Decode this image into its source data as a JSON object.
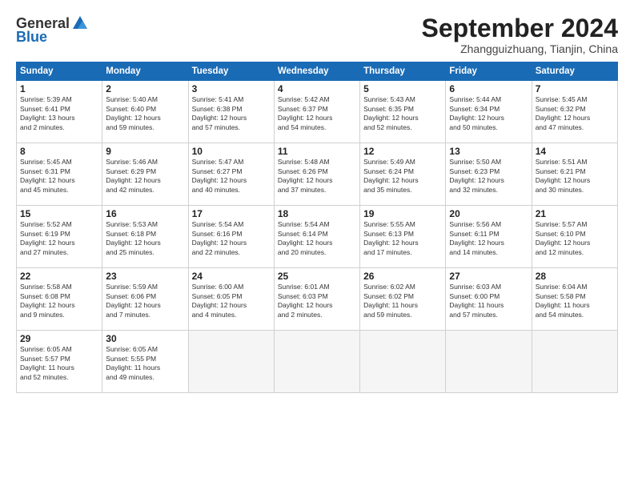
{
  "logo": {
    "general": "General",
    "blue": "Blue"
  },
  "title": "September 2024",
  "subtitle": "Zhangguizhuang, Tianjin, China",
  "days_of_week": [
    "Sunday",
    "Monday",
    "Tuesday",
    "Wednesday",
    "Thursday",
    "Friday",
    "Saturday"
  ],
  "weeks": [
    [
      {
        "day": "1",
        "info": "Sunrise: 5:39 AM\nSunset: 6:41 PM\nDaylight: 13 hours\nand 2 minutes."
      },
      {
        "day": "2",
        "info": "Sunrise: 5:40 AM\nSunset: 6:40 PM\nDaylight: 12 hours\nand 59 minutes."
      },
      {
        "day": "3",
        "info": "Sunrise: 5:41 AM\nSunset: 6:38 PM\nDaylight: 12 hours\nand 57 minutes."
      },
      {
        "day": "4",
        "info": "Sunrise: 5:42 AM\nSunset: 6:37 PM\nDaylight: 12 hours\nand 54 minutes."
      },
      {
        "day": "5",
        "info": "Sunrise: 5:43 AM\nSunset: 6:35 PM\nDaylight: 12 hours\nand 52 minutes."
      },
      {
        "day": "6",
        "info": "Sunrise: 5:44 AM\nSunset: 6:34 PM\nDaylight: 12 hours\nand 50 minutes."
      },
      {
        "day": "7",
        "info": "Sunrise: 5:45 AM\nSunset: 6:32 PM\nDaylight: 12 hours\nand 47 minutes."
      }
    ],
    [
      {
        "day": "8",
        "info": "Sunrise: 5:45 AM\nSunset: 6:31 PM\nDaylight: 12 hours\nand 45 minutes."
      },
      {
        "day": "9",
        "info": "Sunrise: 5:46 AM\nSunset: 6:29 PM\nDaylight: 12 hours\nand 42 minutes."
      },
      {
        "day": "10",
        "info": "Sunrise: 5:47 AM\nSunset: 6:27 PM\nDaylight: 12 hours\nand 40 minutes."
      },
      {
        "day": "11",
        "info": "Sunrise: 5:48 AM\nSunset: 6:26 PM\nDaylight: 12 hours\nand 37 minutes."
      },
      {
        "day": "12",
        "info": "Sunrise: 5:49 AM\nSunset: 6:24 PM\nDaylight: 12 hours\nand 35 minutes."
      },
      {
        "day": "13",
        "info": "Sunrise: 5:50 AM\nSunset: 6:23 PM\nDaylight: 12 hours\nand 32 minutes."
      },
      {
        "day": "14",
        "info": "Sunrise: 5:51 AM\nSunset: 6:21 PM\nDaylight: 12 hours\nand 30 minutes."
      }
    ],
    [
      {
        "day": "15",
        "info": "Sunrise: 5:52 AM\nSunset: 6:19 PM\nDaylight: 12 hours\nand 27 minutes."
      },
      {
        "day": "16",
        "info": "Sunrise: 5:53 AM\nSunset: 6:18 PM\nDaylight: 12 hours\nand 25 minutes."
      },
      {
        "day": "17",
        "info": "Sunrise: 5:54 AM\nSunset: 6:16 PM\nDaylight: 12 hours\nand 22 minutes."
      },
      {
        "day": "18",
        "info": "Sunrise: 5:54 AM\nSunset: 6:14 PM\nDaylight: 12 hours\nand 20 minutes."
      },
      {
        "day": "19",
        "info": "Sunrise: 5:55 AM\nSunset: 6:13 PM\nDaylight: 12 hours\nand 17 minutes."
      },
      {
        "day": "20",
        "info": "Sunrise: 5:56 AM\nSunset: 6:11 PM\nDaylight: 12 hours\nand 14 minutes."
      },
      {
        "day": "21",
        "info": "Sunrise: 5:57 AM\nSunset: 6:10 PM\nDaylight: 12 hours\nand 12 minutes."
      }
    ],
    [
      {
        "day": "22",
        "info": "Sunrise: 5:58 AM\nSunset: 6:08 PM\nDaylight: 12 hours\nand 9 minutes."
      },
      {
        "day": "23",
        "info": "Sunrise: 5:59 AM\nSunset: 6:06 PM\nDaylight: 12 hours\nand 7 minutes."
      },
      {
        "day": "24",
        "info": "Sunrise: 6:00 AM\nSunset: 6:05 PM\nDaylight: 12 hours\nand 4 minutes."
      },
      {
        "day": "25",
        "info": "Sunrise: 6:01 AM\nSunset: 6:03 PM\nDaylight: 12 hours\nand 2 minutes."
      },
      {
        "day": "26",
        "info": "Sunrise: 6:02 AM\nSunset: 6:02 PM\nDaylight: 11 hours\nand 59 minutes."
      },
      {
        "day": "27",
        "info": "Sunrise: 6:03 AM\nSunset: 6:00 PM\nDaylight: 11 hours\nand 57 minutes."
      },
      {
        "day": "28",
        "info": "Sunrise: 6:04 AM\nSunset: 5:58 PM\nDaylight: 11 hours\nand 54 minutes."
      }
    ],
    [
      {
        "day": "29",
        "info": "Sunrise: 6:05 AM\nSunset: 5:57 PM\nDaylight: 11 hours\nand 52 minutes."
      },
      {
        "day": "30",
        "info": "Sunrise: 6:05 AM\nSunset: 5:55 PM\nDaylight: 11 hours\nand 49 minutes."
      },
      {
        "day": "",
        "info": ""
      },
      {
        "day": "",
        "info": ""
      },
      {
        "day": "",
        "info": ""
      },
      {
        "day": "",
        "info": ""
      },
      {
        "day": "",
        "info": ""
      }
    ]
  ]
}
